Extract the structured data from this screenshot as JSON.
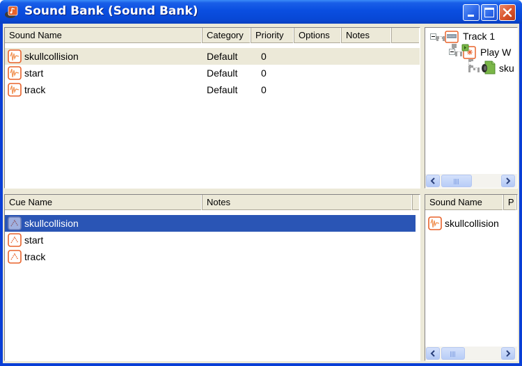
{
  "window": {
    "title": "Sound Bank (Sound Bank)",
    "app_icon": "sound-bank-icon",
    "controls": {
      "minimize": "minimize-icon",
      "maximize": "maximize-icon",
      "close": "close-icon"
    }
  },
  "sounds_table": {
    "columns": [
      "Sound Name",
      "Category",
      "Priority",
      "Options",
      "Notes"
    ],
    "rows": [
      {
        "name": "skullcollision",
        "category": "Default",
        "priority": "0",
        "options": "",
        "notes": "",
        "icon": "sound-wave-icon",
        "highlighted": true
      },
      {
        "name": "start",
        "category": "Default",
        "priority": "0",
        "options": "",
        "notes": "",
        "icon": "sound-wave-icon"
      },
      {
        "name": "track",
        "category": "Default",
        "priority": "0",
        "options": "",
        "notes": "",
        "icon": "sound-wave-icon"
      }
    ]
  },
  "track_tree": {
    "nodes": [
      {
        "label": "Track 1",
        "icon": "track-icon",
        "level": 0,
        "expanded": true
      },
      {
        "label": "Play W",
        "icon": "play-wave-event-icon",
        "level": 1,
        "expanded": true
      },
      {
        "label": "sku",
        "icon": "wave-file-icon",
        "level": 2
      }
    ]
  },
  "cues_table": {
    "columns": [
      "Cue Name",
      "Notes"
    ],
    "rows": [
      {
        "name": "skullcollision",
        "notes": "",
        "icon": "cue-icon",
        "selected": true
      },
      {
        "name": "start",
        "notes": "",
        "icon": "cue-icon"
      },
      {
        "name": "track",
        "notes": "",
        "icon": "cue-icon"
      }
    ]
  },
  "cue_sounds_table": {
    "columns": [
      "Sound Name",
      "P"
    ],
    "rows": [
      {
        "name": "skullcollision",
        "second": "",
        "icon": "sound-wave-icon"
      }
    ]
  },
  "colors": {
    "titlebar": "#0a4ee0",
    "selection": "#2a55b5",
    "highlight_row": "#ece9d8",
    "icon_orange": "#e8622a"
  }
}
